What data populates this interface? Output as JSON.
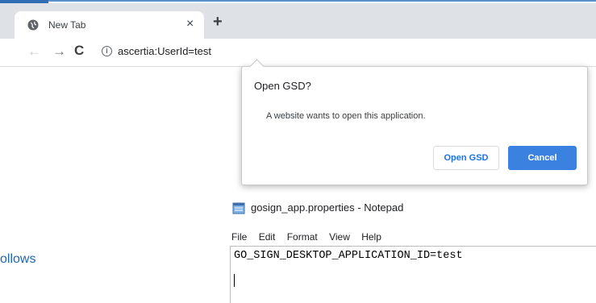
{
  "browser": {
    "tab_title": "New Tab",
    "tab_close": "×",
    "new_tab": "+",
    "back": "←",
    "forward": "→",
    "reload": "C",
    "info": "i",
    "url": "ascertia:UserId=test"
  },
  "dialog": {
    "title": "Open GSD?",
    "message": "A website wants to open this application.",
    "open_button": "Open GSD",
    "cancel_button": "Cancel"
  },
  "notepad": {
    "title": "gosign_app.properties - Notepad",
    "menu": [
      "File",
      "Edit",
      "Format",
      "View",
      "Help"
    ],
    "content": "GO_SIGN_DESKTOP_APPLICATION_ID=test"
  },
  "side_text": "ollows",
  "colors": {
    "primary_button": "#3b82e0",
    "link_blue": "#1a73e8",
    "side_text": "#1f66b3"
  },
  "icons": {
    "tab": "globe-icon",
    "notepad": "notepad-icon",
    "info": "info-icon"
  }
}
